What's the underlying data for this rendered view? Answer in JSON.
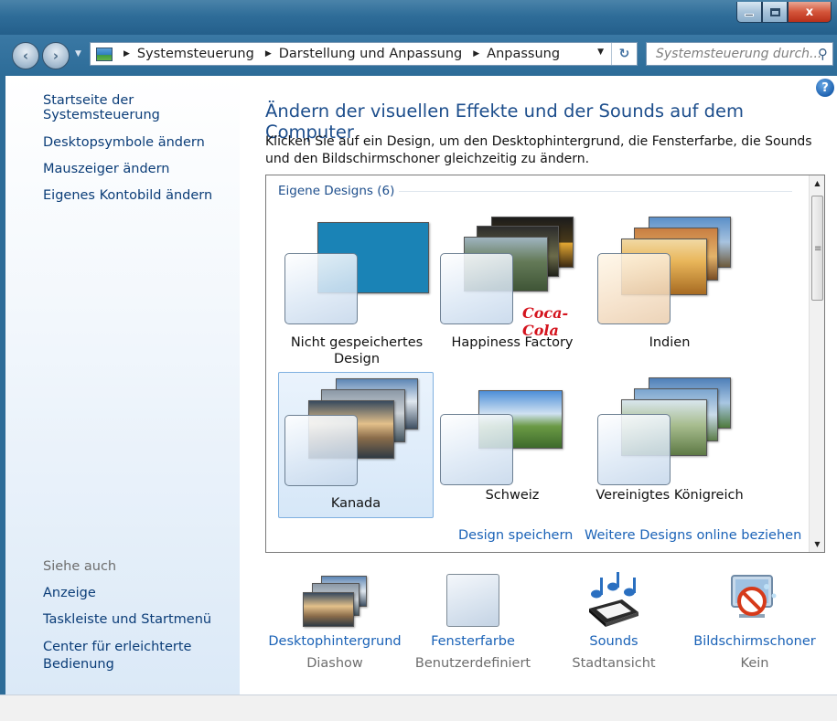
{
  "window": {
    "minimize_symbol": "",
    "maximize_symbol": "",
    "close_symbol": "x"
  },
  "navbar": {
    "back_glyph": "‹",
    "forward_glyph": "›",
    "breadcrumb": [
      "Systemsteuerung",
      "Darstellung und Anpassung",
      "Anpassung"
    ],
    "breadcrumb_separator": "▶",
    "dropdown_glyph": "▼",
    "refresh_glyph": "↻",
    "search_placeholder": "Systemsteuerung durch...",
    "search_glyph": "⚲"
  },
  "sidebar": {
    "items": [
      {
        "label": "Startseite der Systemsteuerung"
      },
      {
        "label": "Desktopsymbole ändern"
      },
      {
        "label": "Mauszeiger ändern"
      },
      {
        "label": "Eigenes Kontobild ändern"
      }
    ],
    "see_also_title": "Siehe auch",
    "see_also": [
      {
        "label": "Anzeige"
      },
      {
        "label": "Taskleiste und Startmenü"
      },
      {
        "label": "Center für erleichterte Bedienung"
      }
    ]
  },
  "main": {
    "help_glyph": "?",
    "title": "Ändern der visuellen Effekte und der Sounds auf dem Computer",
    "description": "Klicken Sie auf ein Design, um den Desktophintergrund, die Fensterfarbe, die Sounds und den Bildschirmschoner gleichzeitig zu ändern.",
    "group_label": "Eigene Designs (6)",
    "themes": [
      {
        "label": "Nicht gespeichertes Design",
        "selected": false
      },
      {
        "label": "Happiness Factory",
        "selected": false,
        "brand": "Coca-Cola"
      },
      {
        "label": "Indien",
        "selected": false
      },
      {
        "label": "Kanada",
        "selected": true
      },
      {
        "label": "Schweiz",
        "selected": false
      },
      {
        "label": "Vereinigtes Königreich",
        "selected": false
      }
    ],
    "links": {
      "save_design": "Design speichern",
      "more_online": "Weitere Designs online beziehen"
    },
    "scroll": {
      "up": "▲",
      "down": "▼",
      "grip": "≡"
    }
  },
  "options": [
    {
      "title": "Desktophintergrund",
      "value": "Diashow"
    },
    {
      "title": "Fensterfarbe",
      "value": "Benutzerdefiniert"
    },
    {
      "title": "Sounds",
      "value": "Stadtansicht"
    },
    {
      "title": "Bildschirmschoner",
      "value": "Kein"
    }
  ],
  "colors": {
    "accent_link": "#1a62b7",
    "title_blue": "#1d4e8c",
    "chrome_blue": "#2d6c98",
    "unsaved_theme_bg": "#1a83b6"
  }
}
